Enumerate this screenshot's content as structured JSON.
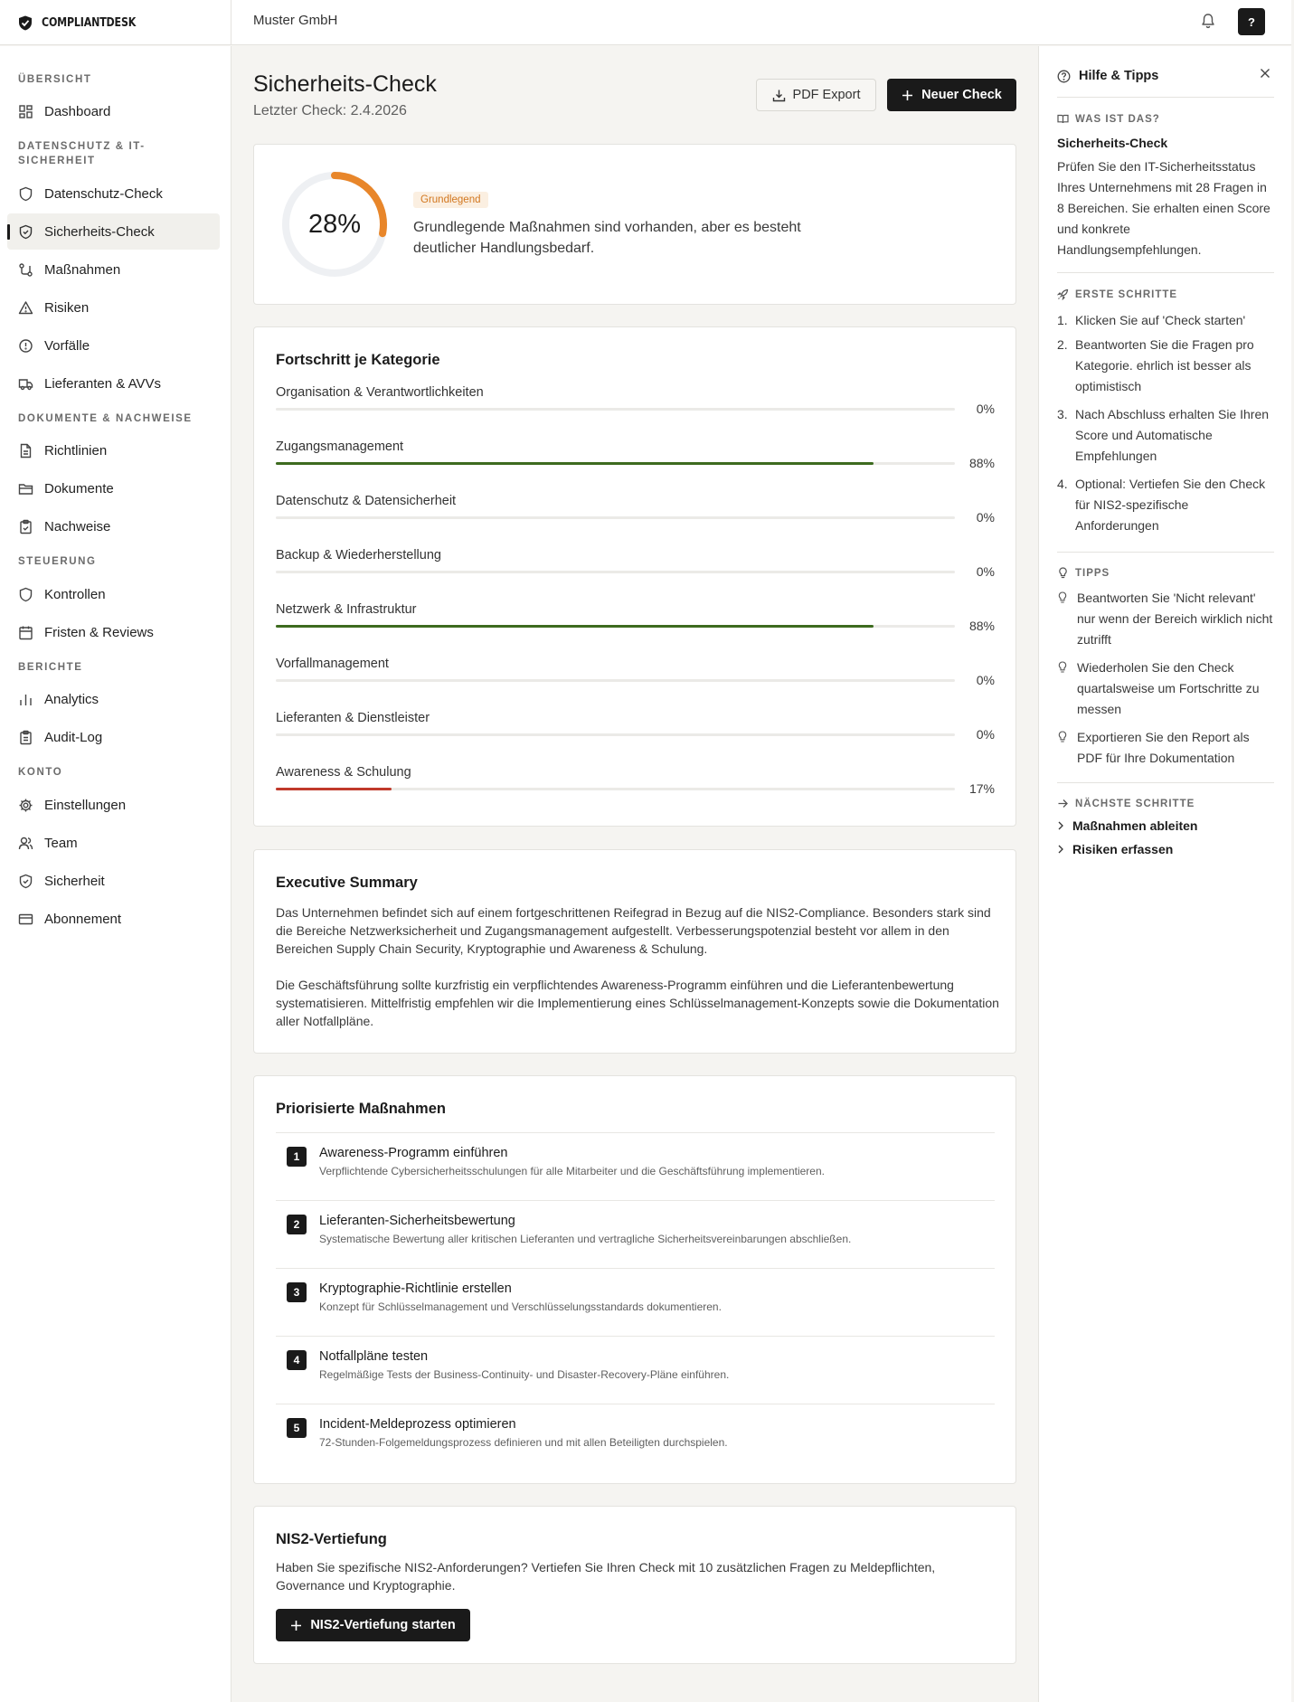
{
  "brand": {
    "name": "COMPLIANTDESK"
  },
  "header": {
    "org": "Muster GmbH",
    "help_label": "?"
  },
  "sidebar": {
    "sections": [
      {
        "title": "ÜBERSICHT",
        "items": [
          {
            "label": "Dashboard",
            "icon": "dashboard-icon"
          }
        ]
      },
      {
        "title": "DATENSCHUTZ & IT-SICHERHEIT",
        "items": [
          {
            "label": "Datenschutz-Check",
            "icon": "shield-icon"
          },
          {
            "label": "Sicherheits-Check",
            "icon": "shield-check-icon",
            "active": true
          },
          {
            "label": "Maßnahmen",
            "icon": "route-icon"
          },
          {
            "label": "Risiken",
            "icon": "warning-icon"
          },
          {
            "label": "Vorfälle",
            "icon": "alert-circle-icon"
          },
          {
            "label": "Lieferanten & AVVs",
            "icon": "truck-icon"
          }
        ]
      },
      {
        "title": "DOKUMENTE & NACHWEISE",
        "items": [
          {
            "label": "Richtlinien",
            "icon": "file-text-icon"
          },
          {
            "label": "Dokumente",
            "icon": "folder-icon"
          },
          {
            "label": "Nachweise",
            "icon": "clipboard-check-icon"
          }
        ]
      },
      {
        "title": "STEUERUNG",
        "items": [
          {
            "label": "Kontrollen",
            "icon": "shield-icon"
          },
          {
            "label": "Fristen & Reviews",
            "icon": "calendar-icon"
          }
        ]
      },
      {
        "title": "BERICHTE",
        "items": [
          {
            "label": "Analytics",
            "icon": "bar-chart-icon"
          },
          {
            "label": "Audit-Log",
            "icon": "clipboard-icon"
          }
        ]
      },
      {
        "title": "KONTO",
        "items": [
          {
            "label": "Einstellungen",
            "icon": "gear-icon"
          },
          {
            "label": "Team",
            "icon": "users-icon"
          },
          {
            "label": "Sicherheit",
            "icon": "shield-check-icon"
          },
          {
            "label": "Abonnement",
            "icon": "credit-card-icon"
          }
        ]
      }
    ]
  },
  "main": {
    "title": "Sicherheits-Check",
    "subtitle": "Letzter Check: 2.4.2026",
    "pdf_export_label": "PDF Export",
    "new_check_label": "Neuer Check",
    "score": {
      "value": 28,
      "display": "28%",
      "badge": "Grundlegend",
      "description": "Grundlegende Maßnahmen sind vorhanden, aber es besteht deutlicher Handlungsbedarf.",
      "ring_color": "#e8862a"
    },
    "categories_title": "Fortschritt je Kategorie",
    "categories": [
      {
        "name": "Organisation & Verantwortlichkeiten",
        "value": 0,
        "display": "0%"
      },
      {
        "name": "Zugangsmanagement",
        "value": 88,
        "display": "88%"
      },
      {
        "name": "Datenschutz & Datensicherheit",
        "value": 0,
        "display": "0%"
      },
      {
        "name": "Backup & Wiederherstellung",
        "value": 0,
        "display": "0%"
      },
      {
        "name": "Netzwerk & Infrastruktur",
        "value": 88,
        "display": "88%"
      },
      {
        "name": "Vorfallmanagement",
        "value": 0,
        "display": "0%"
      },
      {
        "name": "Lieferanten & Dienstleister",
        "value": 0,
        "display": "0%"
      },
      {
        "name": "Awareness & Schulung",
        "value": 17,
        "display": "17%"
      }
    ],
    "colors": {
      "good": "#3d6b1f",
      "bad": "#c0392b"
    },
    "executive": {
      "title": "Executive Summary",
      "p1": "Das Unternehmen befindet sich auf einem fortgeschrittenen Reifegrad in Bezug auf die NIS2-Compliance. Besonders stark sind die Bereiche Netzwerksicherheit und Zugangsmanagement aufgestellt. Verbesserungspotenzial besteht vor allem in den Bereichen Supply Chain Security, Kryptographie und Awareness & Schulung.",
      "p2": "Die Geschäftsführung sollte kurzfristig ein verpflichtendes Awareness-Programm einführen und die Lieferantenbewertung systematisieren. Mittelfristig empfehlen wir die Implementierung eines Schlüsselmanagement-Konzepts sowie die Dokumentation aller Notfallpläne."
    },
    "priorities": {
      "title": "Priorisierte Maßnahmen",
      "items": [
        {
          "num": "1",
          "title": "Awareness-Programm einführen",
          "desc": "Verpflichtende Cybersicherheitsschulungen für alle Mitarbeiter und die Geschäftsführung implementieren."
        },
        {
          "num": "2",
          "title": "Lieferanten-Sicherheitsbewertung",
          "desc": "Systematische Bewertung aller kritischen Lieferanten und vertragliche Sicherheitsvereinbarungen abschließen."
        },
        {
          "num": "3",
          "title": "Kryptographie-Richtlinie erstellen",
          "desc": "Konzept für Schlüsselmanagement und Verschlüsselungsstandards dokumentieren."
        },
        {
          "num": "4",
          "title": "Notfallpläne testen",
          "desc": "Regelmäßige Tests der Business-Continuity- und Disaster-Recovery-Pläne einführen."
        },
        {
          "num": "5",
          "title": "Incident-Meldeprozess optimieren",
          "desc": "72-Stunden-Folgemeldungsprozess definieren und mit allen Beteiligten durchspielen."
        }
      ]
    },
    "nis2": {
      "title": "NIS2-Vertiefung",
      "text": "Haben Sie spezifische NIS2-Anforderungen? Vertiefen Sie Ihren Check mit 10 zusätzlichen Fragen zu Meldepflichten, Governance und Kryptographie.",
      "button": "NIS2-Vertiefung starten"
    }
  },
  "help": {
    "title": "Hilfe & Tipps",
    "what_title": "WAS IST DAS?",
    "what_name": "Sicherheits-Check",
    "what_text": "Prüfen Sie den IT-Sicherheitsstatus Ihres Unternehmens mit 28 Fragen in 8 Bereichen. Sie erhalten einen Score und konkrete Handlungsempfehlungen.",
    "steps_title": "ERSTE SCHRITTE",
    "steps": [
      {
        "n": "1.",
        "t": "Klicken Sie auf 'Check starten'"
      },
      {
        "n": "2.",
        "t": "Beantworten Sie die Fragen pro Kategorie. ehrlich ist besser als optimistisch"
      },
      {
        "n": "3.",
        "t": "Nach Abschluss erhalten Sie Ihren Score und Automatische Empfehlungen"
      },
      {
        "n": "4.",
        "t": "Optional: Vertiefen Sie den Check für NIS2-spezifische Anforderungen"
      }
    ],
    "tips_title": "TIPPS",
    "tips": [
      "Beantworten Sie 'Nicht relevant' nur wenn der Bereich wirklich nicht zutrifft",
      "Wiederholen Sie den Check quartalsweise um Fortschritte zu messen",
      "Exportieren Sie den Report als PDF für Ihre Dokumentation"
    ],
    "next_title": "NÄCHSTE SCHRITTE",
    "next": [
      "Maßnahmen ableiten",
      "Risiken erfassen"
    ]
  }
}
